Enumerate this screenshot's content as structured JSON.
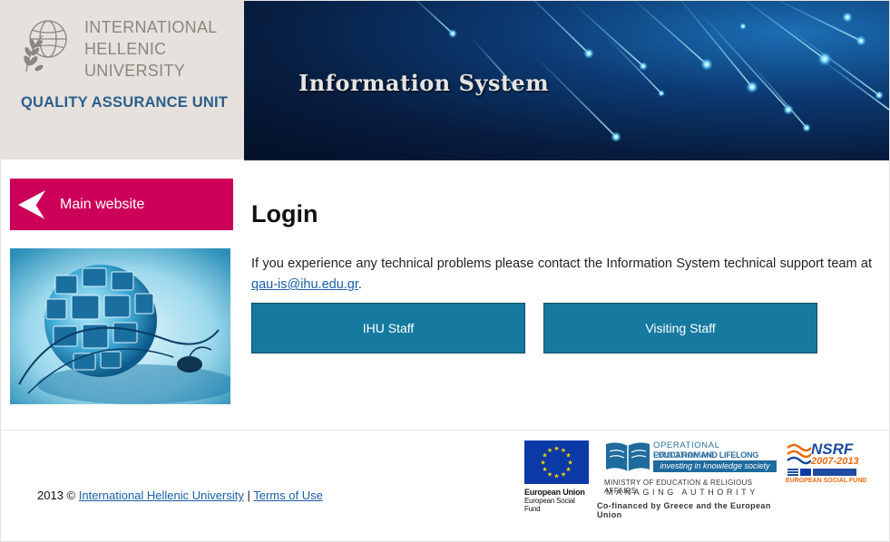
{
  "header": {
    "university_lines": [
      "INTERNATIONAL",
      "HELLENIC",
      "UNIVERSITY"
    ],
    "unit": "QUALITY ASSURANCE UNIT",
    "banner_title": "Information System"
  },
  "sidebar": {
    "main_website_label": "Main website"
  },
  "content": {
    "title": "Login",
    "info_text": "If you experience any technical problems please contact the Information System technical support team at",
    "support_email": "qau-is@ihu.edu.gr",
    "info_suffix": ".",
    "buttons": {
      "ihu_staff": "IHU Staff",
      "visiting_staff": "Visiting Staff"
    }
  },
  "footer": {
    "copyright_prefix": "2013 ©",
    "university_link": "International Hellenic University",
    "separator": "|",
    "terms_link": "Terms of Use",
    "eu_logo": {
      "line1": "European Union",
      "line2": "European Social Fund"
    },
    "op_logo": {
      "line1": "OPERATIONAL PROGRAMME",
      "line2": "EDUCATION AND LIFELONG LEARNING",
      "line3": "investing in knowledge society",
      "line4": "MINISTRY OF EDUCATION & RELIGIOUS AFFAIRS",
      "line5": "MANAGING AUTHORITY",
      "line6": "Co-financed by Greece and the European Union"
    },
    "nsrf_logo": {
      "title": "NSRF",
      "years": "2007-2013",
      "fund": "EUROPEAN SOCIAL FUND"
    }
  },
  "colors": {
    "accent_pink": "#cc0058",
    "button_blue": "#167aa0",
    "unit_blue": "#2c5e8a",
    "link_blue": "#1a5ea8"
  }
}
